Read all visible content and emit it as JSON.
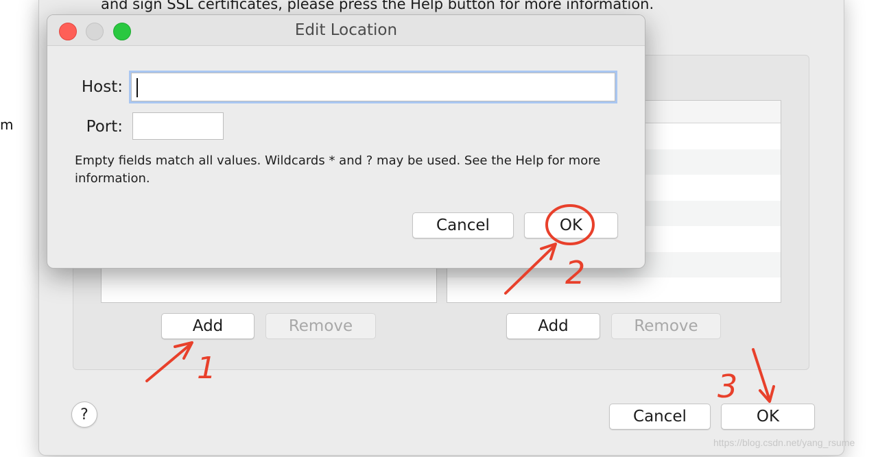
{
  "background": {
    "intro_text": "and sign SSL certificates, please press the Help button for more information.",
    "edge_fragment": "m",
    "left_list": {
      "add_label": "Add",
      "remove_label": "Remove"
    },
    "right_list": {
      "add_label": "Add",
      "remove_label": "Remove"
    },
    "help_label": "?",
    "cancel_label": "Cancel",
    "ok_label": "OK"
  },
  "dialog": {
    "title": "Edit Location",
    "host": {
      "label": "Host:",
      "value": ""
    },
    "port": {
      "label": "Port:",
      "value": ""
    },
    "info_text": "Empty fields match all values. Wildcards * and ? may be used. See the Help for more information.",
    "cancel_label": "Cancel",
    "ok_label": "OK"
  },
  "annotations": {
    "color": "#e8402b",
    "step1": "1",
    "step2": "2",
    "step3": "3"
  },
  "watermark": "https://blog.csdn.net/yang_rsume"
}
